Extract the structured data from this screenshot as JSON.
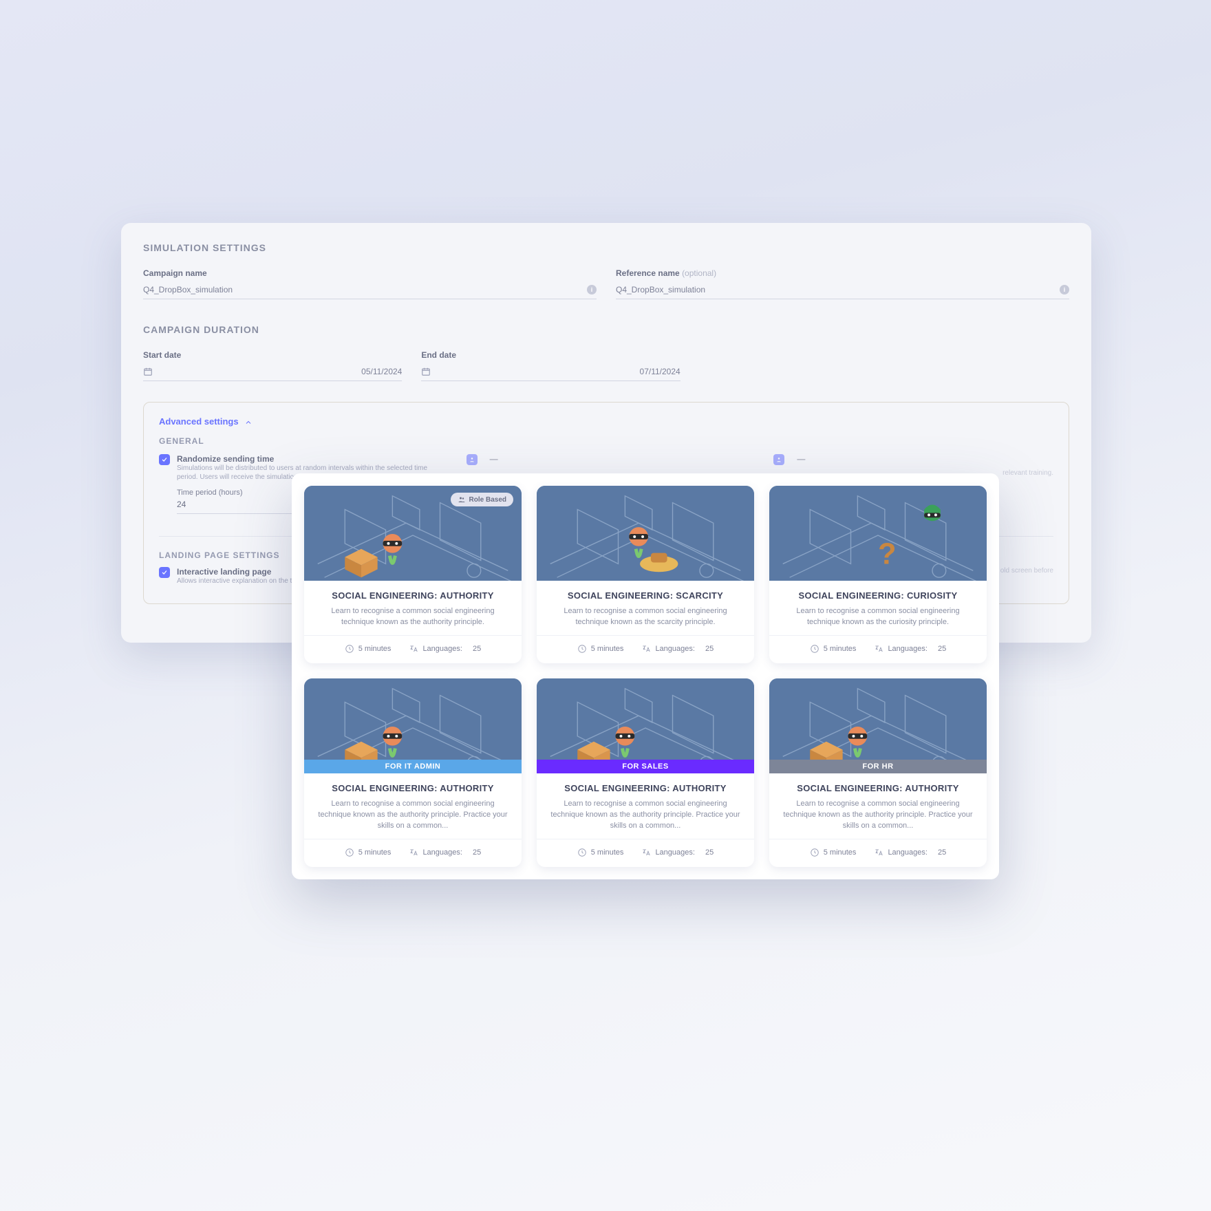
{
  "settings": {
    "section_title": "SIMULATION SETTINGS",
    "campaign_name_label": "Campaign name",
    "campaign_name_value": "Q4_DropBox_simulation",
    "reference_name_label": "Reference name",
    "reference_name_optional": "(optional)",
    "reference_name_value": "Q4_DropBox_simulation",
    "duration_title": "CAMPAIGN DURATION",
    "start_label": "Start date",
    "start_value": "05/11/2024",
    "end_label": "End date",
    "end_value": "07/11/2024",
    "advanced": {
      "toggle_label": "Advanced settings",
      "general_label": "GENERAL",
      "randomize_label": "Randomize sending time",
      "randomize_desc": "Simulations will be distributed to users at random intervals within the selected time period. Users will receive the simulations at times when they are most engaged.",
      "time_period_label": "Time period (hours)",
      "time_period_value": "24",
      "partial_text": "relevant training.",
      "landing_title": "LANDING PAGE SETTINGS",
      "interactive_label": "Interactive landing page",
      "interactive_desc": "Allows interactive explanation on the template.",
      "right_text": "old screen before"
    }
  },
  "cards": [
    {
      "title": "SOCIAL ENGINEERING: AUTHORITY",
      "desc": "Learn to recognise a common social engineering technique known as the authority principle.",
      "duration": "5 minutes",
      "lang_label": "Languages:",
      "lang_count": "25",
      "role_pill": "Role Based",
      "for_bar": ""
    },
    {
      "title": "SOCIAL ENGINEERING: SCARCITY",
      "desc": "Learn to recognise a common social engineering technique known as the scarcity principle.",
      "duration": "5 minutes",
      "lang_label": "Languages:",
      "lang_count": "25",
      "role_pill": "",
      "for_bar": ""
    },
    {
      "title": "SOCIAL ENGINEERING: CURIOSITY",
      "desc": "Learn to recognise a common social engineering technique known as the curiosity principle.",
      "duration": "5 minutes",
      "lang_label": "Languages:",
      "lang_count": "25",
      "role_pill": "",
      "for_bar": ""
    },
    {
      "title": "SOCIAL ENGINEERING: AUTHORITY",
      "desc": "Learn to recognise a common social engineering technique known as the authority principle. Practice your skills on a common...",
      "duration": "5 minutes",
      "lang_label": "Languages:",
      "lang_count": "25",
      "role_pill": "",
      "for_bar": "FOR IT ADMIN",
      "for_class": "for-it"
    },
    {
      "title": "SOCIAL ENGINEERING: AUTHORITY",
      "desc": "Learn to recognise a common social engineering technique known as the authority principle. Practice your skills on a common...",
      "duration": "5 minutes",
      "lang_label": "Languages:",
      "lang_count": "25",
      "role_pill": "",
      "for_bar": "FOR SALES",
      "for_class": "for-sales"
    },
    {
      "title": "SOCIAL ENGINEERING: AUTHORITY",
      "desc": "Learn to recognise a common social engineering technique known as the authority principle. Practice your skills on a common...",
      "duration": "5 minutes",
      "lang_label": "Languages:",
      "lang_count": "25",
      "role_pill": "",
      "for_bar": "FOR HR",
      "for_class": "for-hr"
    }
  ]
}
